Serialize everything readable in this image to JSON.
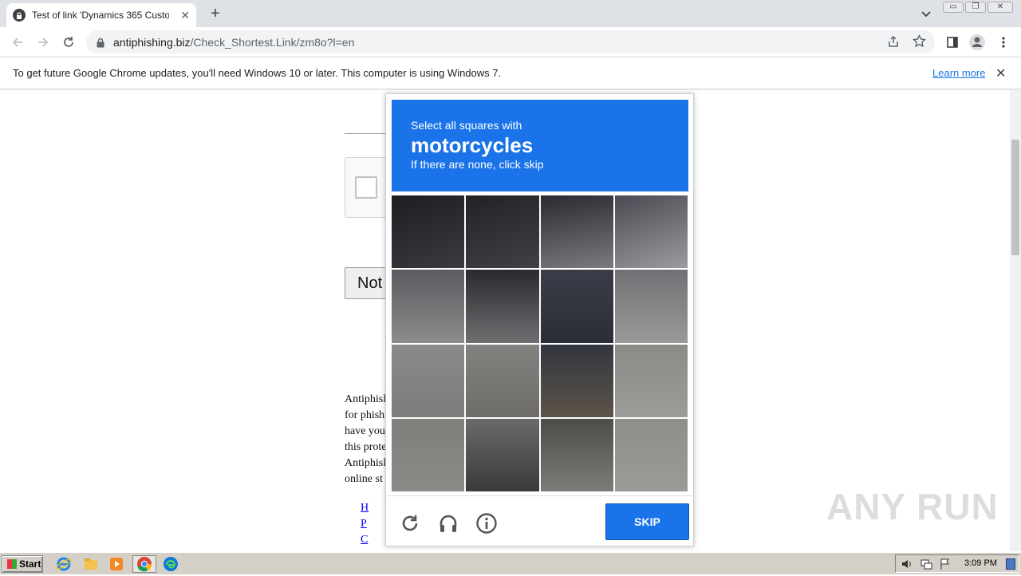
{
  "browser": {
    "tab_title": "Test of link 'Dynamics 365 Customer",
    "tab_close": "✕",
    "new_tab": "+",
    "url_host": "antiphishing.biz",
    "url_path": "/Check_Shortest.Link/zm8o?l=en",
    "window_minimize": "▭",
    "window_restore": "❐",
    "window_close": "✕"
  },
  "infobar": {
    "message": "To get future Google Chrome updates, you'll need Windows 10 or later. This computer is using Windows 7.",
    "learn_more": "Learn more",
    "close": "✕"
  },
  "page": {
    "not_button": "Not",
    "paragraph_lines": [
      "Antiphisl",
      "for phish",
      "have you",
      "this prote",
      "Antiphisl",
      "online st"
    ],
    "links": [
      "H",
      "P",
      "C"
    ]
  },
  "captcha": {
    "line1": "Select all squares with",
    "keyword": "motorcycles",
    "line3": "If there are none, click skip",
    "skip_label": "SKIP",
    "header_color": "#1a73e8"
  },
  "watermark": "ANY RUN",
  "taskbar": {
    "start": "Start",
    "clock": "3:09 PM"
  },
  "icons": [
    "lock-icon",
    "back-icon",
    "forward-icon",
    "reload-icon",
    "share-icon",
    "star-icon",
    "sidepanel-icon",
    "profile-icon",
    "menu-icon",
    "refresh-icon",
    "headphones-icon",
    "info-icon"
  ]
}
